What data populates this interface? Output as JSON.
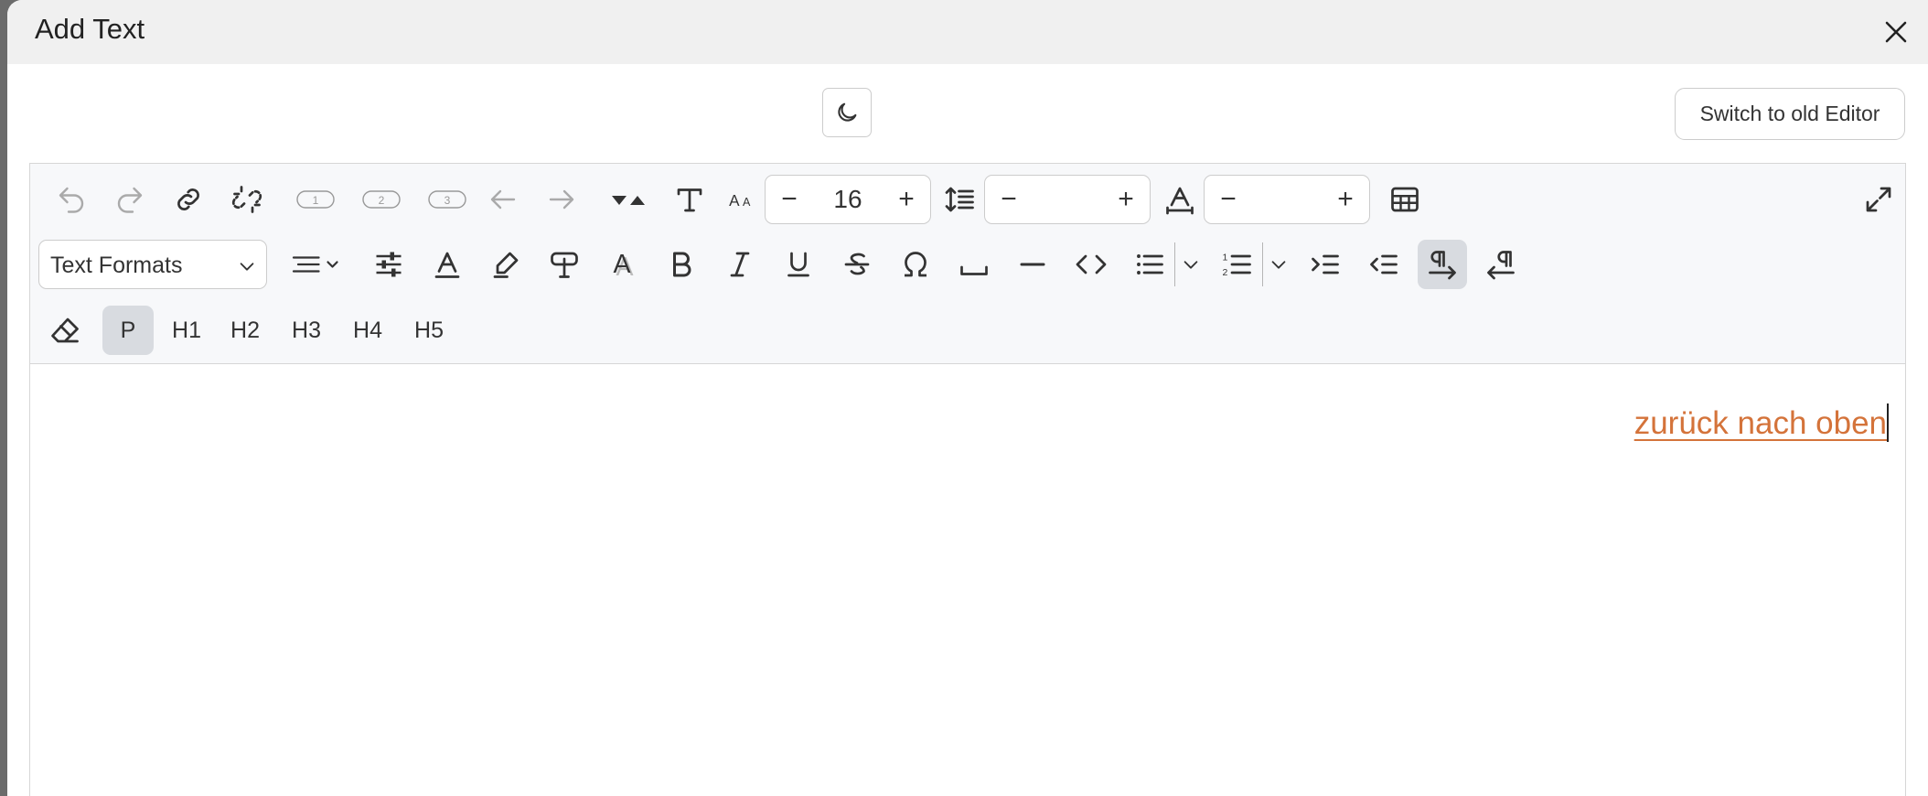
{
  "dialog": {
    "title": "Add Text"
  },
  "header": {
    "switch_label": "Switch to old Editor"
  },
  "toolbar": {
    "badges": [
      "1",
      "2",
      "3"
    ],
    "font_size": {
      "value": "16",
      "minus": "−",
      "plus": "+"
    },
    "line_height": {
      "value": "",
      "minus": "−",
      "plus": "+"
    },
    "letter_spacing": {
      "value": "",
      "minus": "−",
      "plus": "+"
    },
    "text_formats_label": "Text Formats",
    "paragraph_label": "P",
    "headings": [
      "H1",
      "H2",
      "H3",
      "H4",
      "H5"
    ]
  },
  "content": {
    "link_text": "zurück nach oben"
  },
  "colors": {
    "link": "#d4733a",
    "toolbar_bg": "#f7f8fa",
    "titlebar_bg": "#f0f0f0",
    "active_bg": "#d8dbe0"
  }
}
